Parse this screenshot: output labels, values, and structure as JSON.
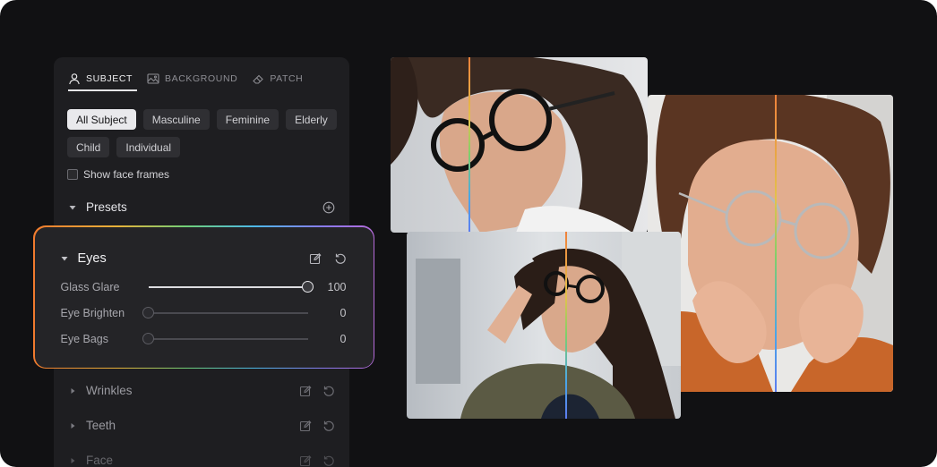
{
  "tabs": [
    {
      "label": "SUBJECT",
      "icon": "user-icon",
      "active": true
    },
    {
      "label": "BACKGROUND",
      "icon": "image-icon",
      "active": false
    },
    {
      "label": "PATCH",
      "icon": "eraser-icon",
      "active": false
    }
  ],
  "filters": [
    {
      "label": "All Subject",
      "active": true
    },
    {
      "label": "Masculine",
      "active": false
    },
    {
      "label": "Feminine",
      "active": false
    },
    {
      "label": "Elderly",
      "active": false
    },
    {
      "label": "Child",
      "active": false
    },
    {
      "label": "Individual",
      "active": false
    }
  ],
  "show_face_frames": {
    "label": "Show face frames",
    "checked": false
  },
  "presets": {
    "label": "Presets"
  },
  "eyes": {
    "label": "Eyes",
    "sliders": [
      {
        "name": "Glass Glare",
        "value": "100",
        "level": 1.0
      },
      {
        "name": "Eye Brighten",
        "value": "0",
        "level": 0.0
      },
      {
        "name": "Eye Bags",
        "value": "0",
        "level": 0.0
      }
    ]
  },
  "sections": [
    {
      "label": "Wrinkles"
    },
    {
      "label": "Teeth"
    },
    {
      "label": "Face"
    }
  ],
  "colors": {
    "background": "#111113",
    "panel": "#1e1e21",
    "accent_gradient": [
      "#f07a2e",
      "#e6b23a",
      "#6fcf78",
      "#4db8e8",
      "#8a7bf0",
      "#b46ad8"
    ]
  }
}
